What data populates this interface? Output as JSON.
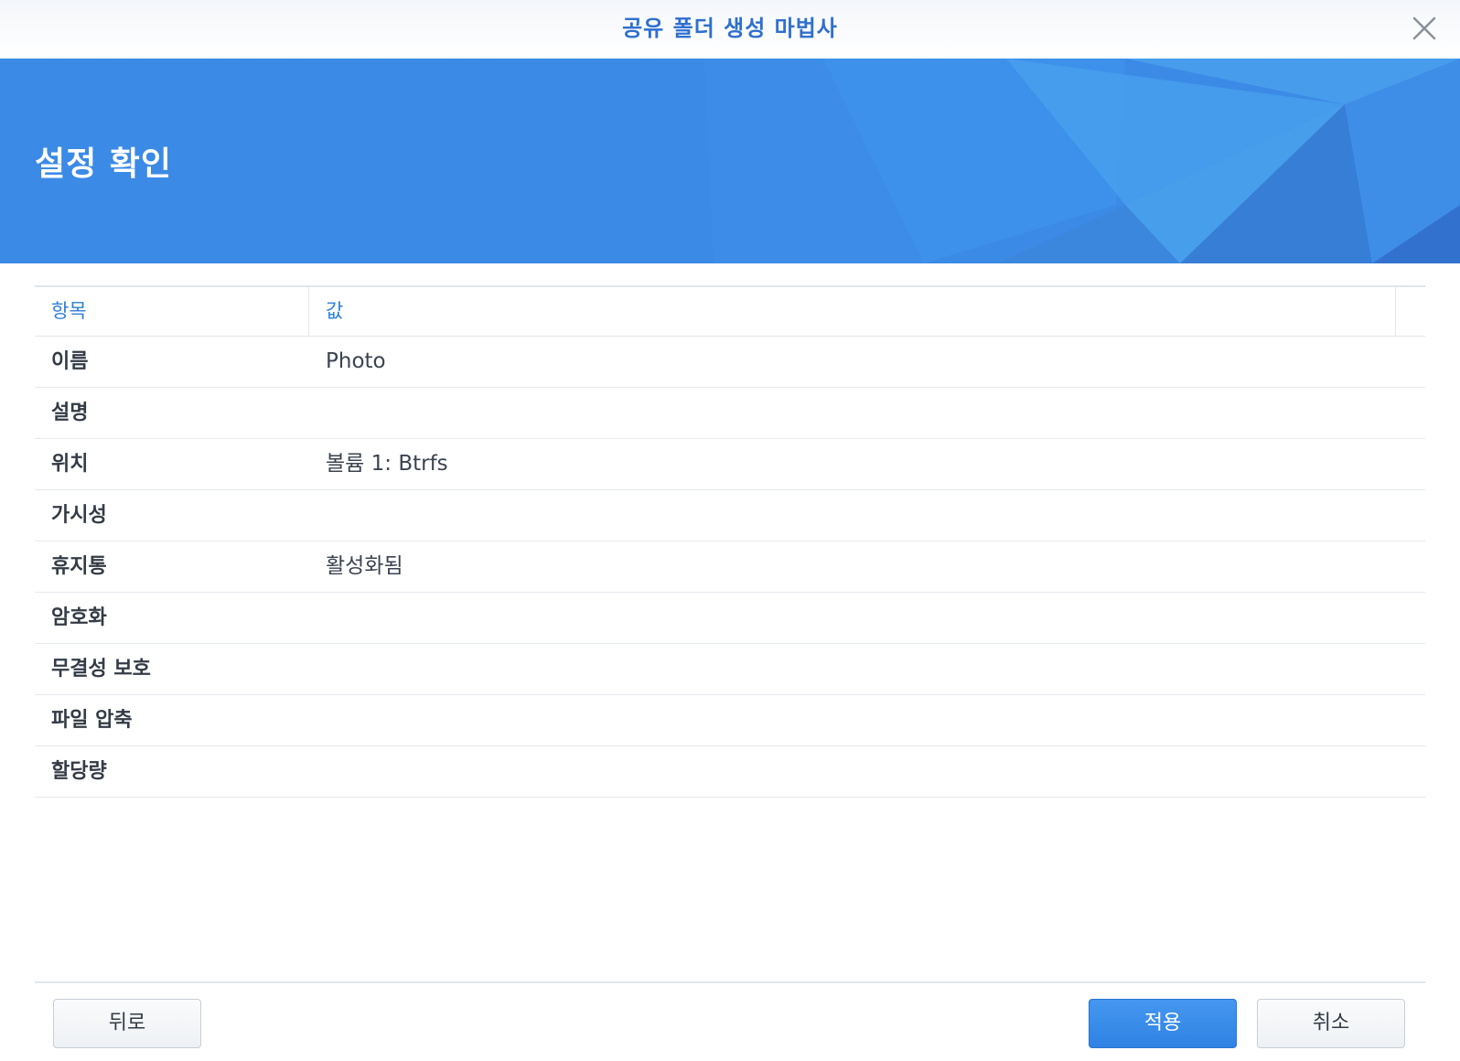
{
  "window": {
    "title": "공유 폴더 생성 마법사"
  },
  "banner": {
    "heading": "설정 확인"
  },
  "table": {
    "columns": {
      "item": "항목",
      "value": "값"
    },
    "rows": [
      {
        "label": "이름",
        "value": "Photo"
      },
      {
        "label": "설명",
        "value": ""
      },
      {
        "label": "위치",
        "value": "볼륨 1: Btrfs"
      },
      {
        "label": "가시성",
        "value": ""
      },
      {
        "label": "휴지통",
        "value": "활성화됨"
      },
      {
        "label": "암호화",
        "value": ""
      },
      {
        "label": "무결성 보호",
        "value": ""
      },
      {
        "label": "파일 압축",
        "value": ""
      },
      {
        "label": "할당량",
        "value": ""
      }
    ]
  },
  "footer": {
    "back_label": "뒤로",
    "apply_label": "적용",
    "cancel_label": "취소"
  },
  "icons": {
    "close": "close-icon"
  },
  "colors": {
    "accent": "#2f80d8",
    "banner": "#3b8ae6",
    "primary_button": "#3a8ce9"
  }
}
